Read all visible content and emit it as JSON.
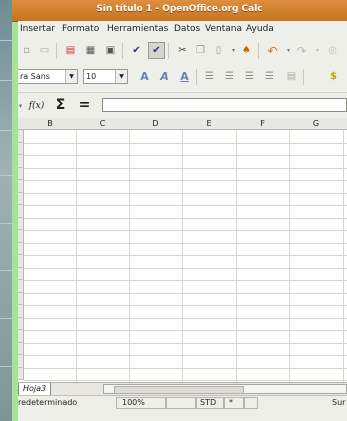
{
  "window": {
    "title": "Sin título 1 - OpenOffice.org Calc"
  },
  "menu": {
    "items": [
      {
        "label": "Insertar"
      },
      {
        "label": "Formato"
      },
      {
        "label": "Herramientas"
      },
      {
        "label": "Datos"
      },
      {
        "label": "Ventana"
      },
      {
        "label": "Ayuda"
      }
    ]
  },
  "formatting": {
    "font_name": "ra Sans",
    "font_size": "10"
  },
  "formula_bar": {
    "function_wizard_label": "f(x)",
    "sum_symbol": "Σ",
    "equals_symbol": "=",
    "value": ""
  },
  "sheet": {
    "columns": [
      "B",
      "C",
      "D",
      "E",
      "F",
      "G"
    ],
    "tab_label": "Hoja3"
  },
  "status": {
    "page_style": "redeterminado",
    "zoom": "100%",
    "selection_mode": "STD",
    "modified": "*",
    "sum_label": "Sur"
  },
  "colors": {
    "titlebar": "#d27f2c",
    "window_frame": "#a6e29a",
    "background": "#efefe9"
  }
}
